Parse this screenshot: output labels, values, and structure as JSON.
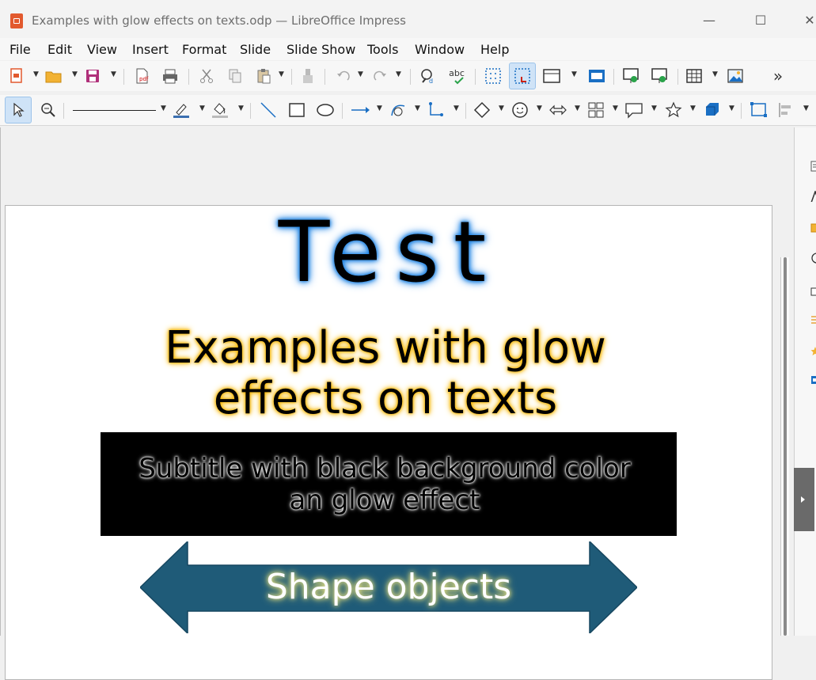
{
  "window": {
    "title": "Examples with glow effects on texts.odp — LibreOffice Impress",
    "controls": {
      "minimize": "—",
      "maximize": "☐",
      "close": "✕"
    }
  },
  "menu": [
    "File",
    "Edit",
    "View",
    "Insert",
    "Format",
    "Slide",
    "Slide Show",
    "Tools",
    "Window",
    "Help"
  ],
  "toolbar": {
    "overflow": "»",
    "spelling_label": "abc"
  },
  "slide": {
    "title": "Test",
    "text_line1": "Examples with glow",
    "text_line2": "effects on texts",
    "subtitle_line1": "Subtitle with black background color",
    "subtitle_line2": "an glow effect",
    "shape_text": "Shape objects"
  },
  "colors": {
    "title_glow": "#1a7fe0",
    "text_glow": "#f5b400",
    "arrow_fill": "#1f5b78",
    "shape_text_glow": "#f2e98a",
    "active_button": "#cfe3f7"
  }
}
